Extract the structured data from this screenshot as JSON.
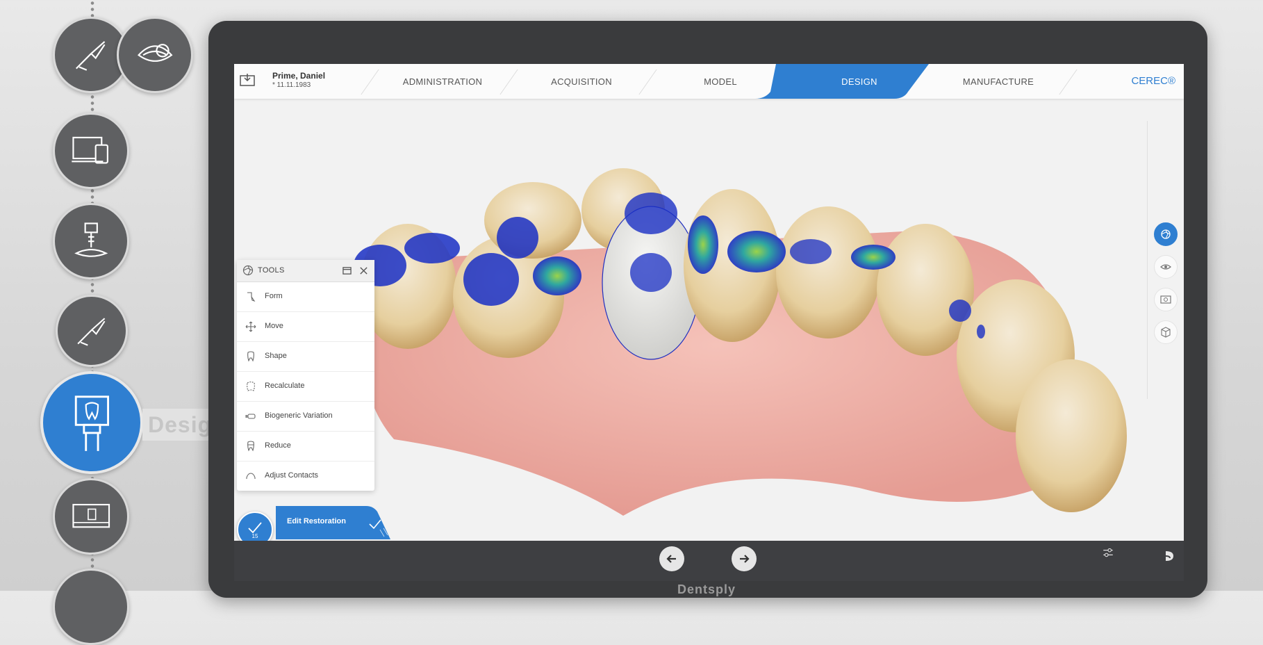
{
  "workflow": {
    "design_label": "Design"
  },
  "patient": {
    "name": "Prime, Daniel",
    "dob": "* 11.11.1983"
  },
  "nav": {
    "tabs": [
      "ADMINISTRATION",
      "ACQUISITION",
      "MODEL",
      "DESIGN",
      "MANUFACTURE"
    ],
    "active": "DESIGN",
    "brand": "CEREC®"
  },
  "tools": {
    "title": "TOOLS",
    "items": [
      "Form",
      "Move",
      "Shape",
      "Recalculate",
      "Biogeneric Variation",
      "Reduce",
      "Adjust Contacts"
    ]
  },
  "step": {
    "number": "15",
    "label": "Edit Restoration"
  },
  "colors": {
    "accent": "#2f7fd1",
    "bottombar": "#3e3f42"
  },
  "monitor_brand": "Dentsply"
}
